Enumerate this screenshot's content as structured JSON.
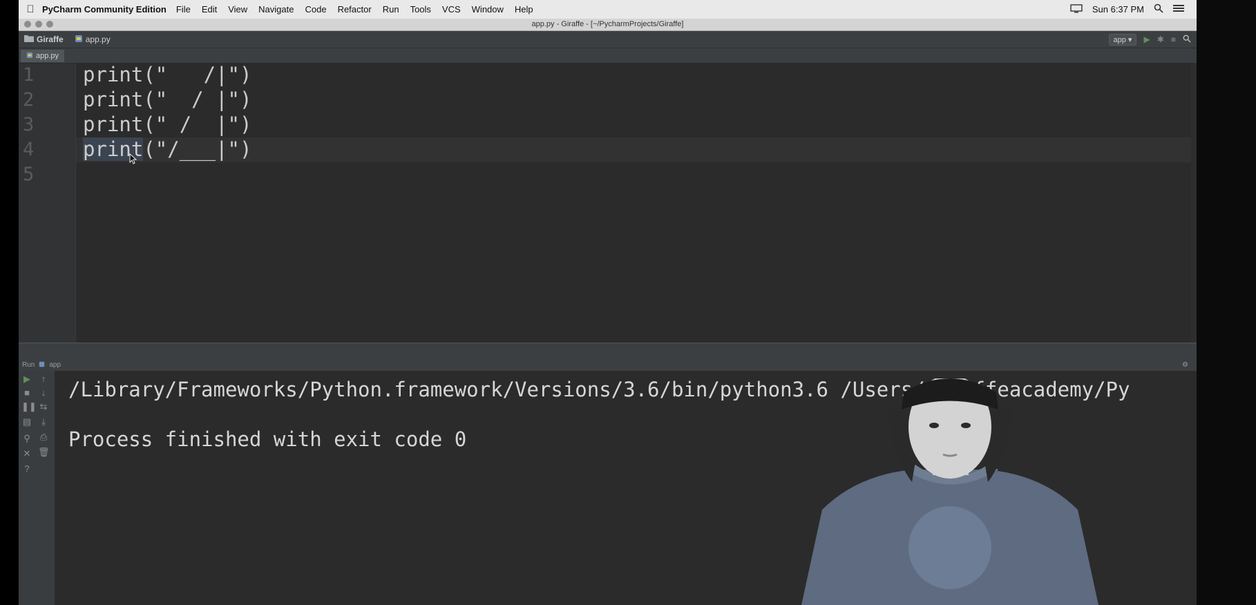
{
  "menubar": {
    "app_name": "PyCharm Community Edition",
    "items": [
      "File",
      "Edit",
      "View",
      "Navigate",
      "Code",
      "Refactor",
      "Run",
      "Tools",
      "VCS",
      "Window",
      "Help"
    ],
    "clock": "Sun 6:37 PM"
  },
  "window": {
    "title": "app.py - Giraffe - [~/PycharmProjects/Giraffe]"
  },
  "navbar": {
    "project": "Giraffe",
    "file": "app.py",
    "run_config": "app"
  },
  "tabs": [
    {
      "label": "app.py"
    }
  ],
  "editor": {
    "line_numbers": [
      "1",
      "2",
      "3",
      "4",
      "5"
    ],
    "lines": [
      {
        "fn": "print",
        "rest": "(\"   /|\")"
      },
      {
        "fn": "print",
        "rest": "(\"  / |\")"
      },
      {
        "fn": "print",
        "rest": "(\" /  |\")"
      },
      {
        "fn": "print",
        "rest": "(\"/___|\")"
      },
      {
        "fn": "",
        "rest": ""
      }
    ]
  },
  "run_panel": {
    "header_label": "Run",
    "config": "app",
    "console_lines": [
      "/Library/Frameworks/Python.framework/Versions/3.6/bin/python3.6 /Users/giraffeacademy/Py",
      "Process finished with exit code 0"
    ]
  }
}
